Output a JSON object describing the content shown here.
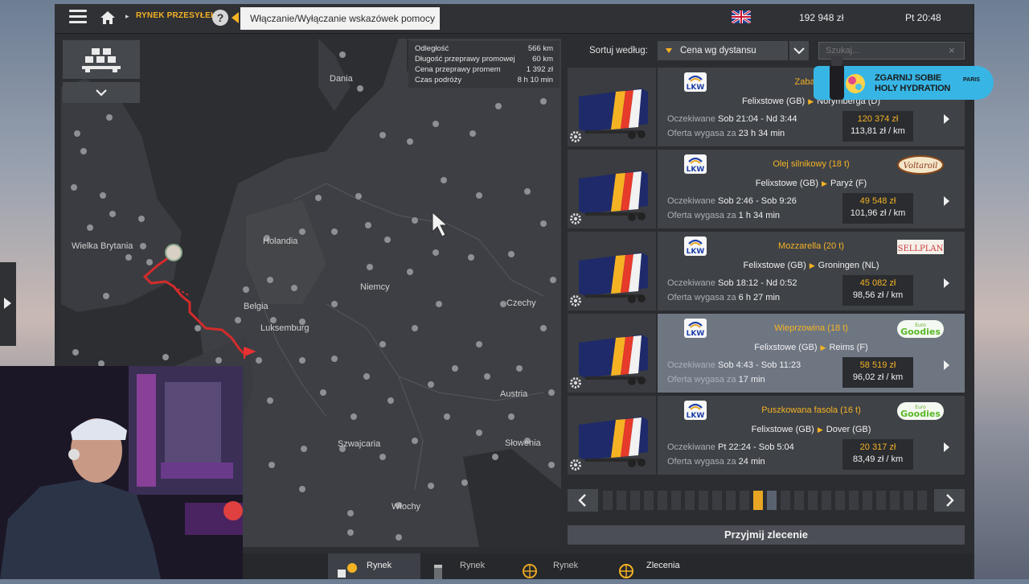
{
  "topbar": {
    "breadcrumb": "RYNEK PRZESYŁEK",
    "help_symbol": "?",
    "tooltip": "Włączanie/Wyłączanie wskazówek pomocy",
    "money": "192 948 zł",
    "time": "Pt 20:48"
  },
  "map": {
    "info": [
      {
        "label": "Odległość",
        "value": "566 km"
      },
      {
        "label": "Długość przeprawy promowej",
        "value": "60 km"
      },
      {
        "label": "Cena przeprawy promem",
        "value": "1 392 zł"
      },
      {
        "label": "Czas podróży",
        "value": "8 h 10 min"
      }
    ],
    "labels": {
      "dania": "Dania",
      "wielka_brytania": "Wielka Brytania",
      "holandia": "Holandia",
      "belgia": "Belgia",
      "luksemburg": "Luksemburg",
      "niemcy": "Niemcy",
      "czechy": "Czechy",
      "austria": "Austria",
      "szwajcaria": "Szwajcaria",
      "slowenia": "Słowenia",
      "wlochy": "Włochy"
    }
  },
  "sort": {
    "label": "Sortuj według:",
    "selected": "Cena wg dystansu",
    "search_placeholder": "Szukaj..."
  },
  "offers": [
    {
      "cargo": "Zabawki",
      "from": "Felixstowe (GB)",
      "to": "Norymberga (D)",
      "expected_label": "Oczekiwane",
      "expected": "Sob 21:04 - Nd 3:44",
      "expires_label": "Oferta wygasa za",
      "expires": "23 h 34 min",
      "price": "120 374 zł",
      "per_km": "113,81 zł / km",
      "brand": "lkw-logo"
    },
    {
      "cargo": "Olej silnikowy (18 t)",
      "from": "Felixstowe (GB)",
      "to": "Paryż (F)",
      "expected_label": "Oczekiwane",
      "expected": "Sob 2:46 - Sob 9:26",
      "expires_label": "Oferta wygasa za",
      "expires": "1 h 34 min",
      "price": "49 548 zł",
      "per_km": "101,96 zł / km",
      "brand": "Voltaroil"
    },
    {
      "cargo": "Mozzarella (20 t)",
      "from": "Felixstowe (GB)",
      "to": "Groningen (NL)",
      "expected_label": "Oczekiwane",
      "expected": "Sob 18:12 - Nd 0:52",
      "expires_label": "Oferta wygasa za",
      "expires": "6 h 27 min",
      "price": "45 082 zł",
      "per_km": "98,56 zł / km",
      "brand": "SellPlan"
    },
    {
      "cargo": "Wieprzowina (18 t)",
      "from": "Felixstowe (GB)",
      "to": "Reims (F)",
      "expected_label": "Oczekiwane",
      "expected": "Sob 4:43 - Sob 11:23",
      "expires_label": "Oferta wygasa za",
      "expires": "17 min",
      "price": "58 519 zł",
      "per_km": "96,02 zł / km",
      "brand": "Goodies"
    },
    {
      "cargo": "Puszkowana fasola (16 t)",
      "from": "Felixstowe (GB)",
      "to": "Dover (GB)",
      "expected_label": "Oczekiwane",
      "expected": "Pt 22:24 - Sob 5:04",
      "expires_label": "Oferta wygasa za",
      "expires": "24 min",
      "price": "20 317 zł",
      "per_km": "83,49 zł / km",
      "brand": "Goodies"
    }
  ],
  "brands": {
    "lkw": "LKW",
    "voltaroil": "Voltaroil",
    "sellplan": "SELLPLAN",
    "goodies_top": "Euro",
    "goodies": "Goodies"
  },
  "accept_label": "Przyjmij zlecenie",
  "tabs": [
    "Rynek",
    "Rynek",
    "Rynek",
    "Zlecenia"
  ],
  "ad": {
    "line1": "ZGARNIJ SOBIE",
    "line2": "HOLY HYDRATION",
    "tag": "PARIS"
  },
  "colors": {
    "accent": "#f5b324",
    "panel": "#3f4247",
    "selected": "#6e7682"
  }
}
